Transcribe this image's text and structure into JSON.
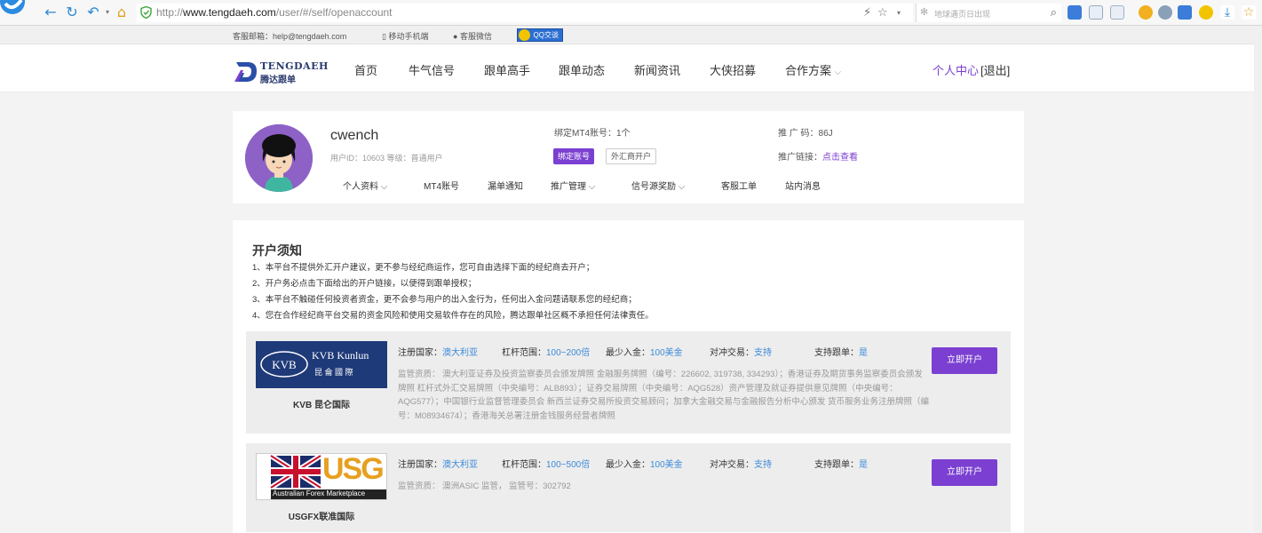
{
  "browser": {
    "url_prefix": "http://",
    "url_host": "www.tengdaeh.com",
    "url_path": "/user/#/self/openaccount",
    "search_placeholder": "地球遇页日出现"
  },
  "topstrip": {
    "email": "客服邮箱：help@tengdaeh.com",
    "mobile": "移动手机端",
    "wechat": "客服微信",
    "qq": "QQ交谈"
  },
  "nav": {
    "brand_en": "TENGDAEH",
    "brand_cn": "腾达跟单",
    "items": [
      "首页",
      "牛气信号",
      "跟单高手",
      "跟单动态",
      "新闻资讯",
      "大侠招募",
      "合作方案"
    ],
    "user_center": "个人中心",
    "logout": "[退出]"
  },
  "profile": {
    "username": "cwench",
    "meta": "用户ID：10603   等级：普通用户",
    "mt4_count": "绑定MT4账号：1个",
    "bind_button": "绑定账号",
    "broker_button": "外汇商开户",
    "promo_code": "推 广 码：86J",
    "promo_link_label": "推广链接：",
    "promo_link_text": "点击查看",
    "tabs": [
      "个人资料",
      "MT4账号",
      "漏单通知",
      "推广管理",
      "信号源奖励",
      "客服工单",
      "站内消息"
    ]
  },
  "notice": {
    "title": "开户须知",
    "lines": [
      "1、本平台不提供外汇开户建议，更不参与经纪商运作，您可自由选择下面的经纪商去开户；",
      "2、开户务必点击下面给出的开户链接，以便得到跟单授权；",
      "3、本平台不触碰任何投资者资金，更不会参与用户的出入金行为，任何出入金问题请联系您的经纪商；",
      "4、您在合作经纪商平台交易的资金风险和使用交易软件存在的风险，腾达跟单社区概不承担任何法律责任。"
    ]
  },
  "brokers": [
    {
      "name": "KVB 昆仑国际",
      "logo_text": "KVB Kunlun",
      "logo_cn": "昆 侖 國 際",
      "country_label": "注册国家：",
      "country": "澳大利亚",
      "leverage_label": "杠杆范围：",
      "leverage": "100~200倍",
      "min_label": "最少入金：",
      "min": "100美金",
      "hedge_label": "对冲交易：",
      "hedge": "支持",
      "copy_label": "支持跟单：",
      "copy": "是",
      "regulation": "监管资质： 澳大利亚证券及投资监察委员会颁发牌照 金融服务牌照（编号：226602, 319738, 334293）；香港证券及期货事务监察委员会颁发牌照 杠杆式外汇交易牌照（中央编号：ALB893）；证券交易牌照（中央编号：AQG528）资产管理及就证券提供意见牌照（中央编号：AQG577）；中国银行业监督管理委员会 新西兰证券交易所投资交易顾问；加拿大金融交易与金融报告分析中心颁发 货币服务业务注册牌照（编号：M08934674）；香港海关总署注册金钱服务经营者牌照",
      "button": "立即开户"
    },
    {
      "name": "USGFX联准国际",
      "logo_text": "USG",
      "logo_sub": "Australian Forex Marketplace",
      "country_label": "注册国家：",
      "country": "澳大利亚",
      "leverage_label": "杠杆范围：",
      "leverage": "100~500倍",
      "min_label": "最少入金：",
      "min": "100美金",
      "hedge_label": "对冲交易：",
      "hedge": "支持",
      "copy_label": "支持跟单：",
      "copy": "是",
      "regulation": "监管资质： 澳洲ASIC 监管， 监管号：302792",
      "button": "立即开户"
    }
  ]
}
